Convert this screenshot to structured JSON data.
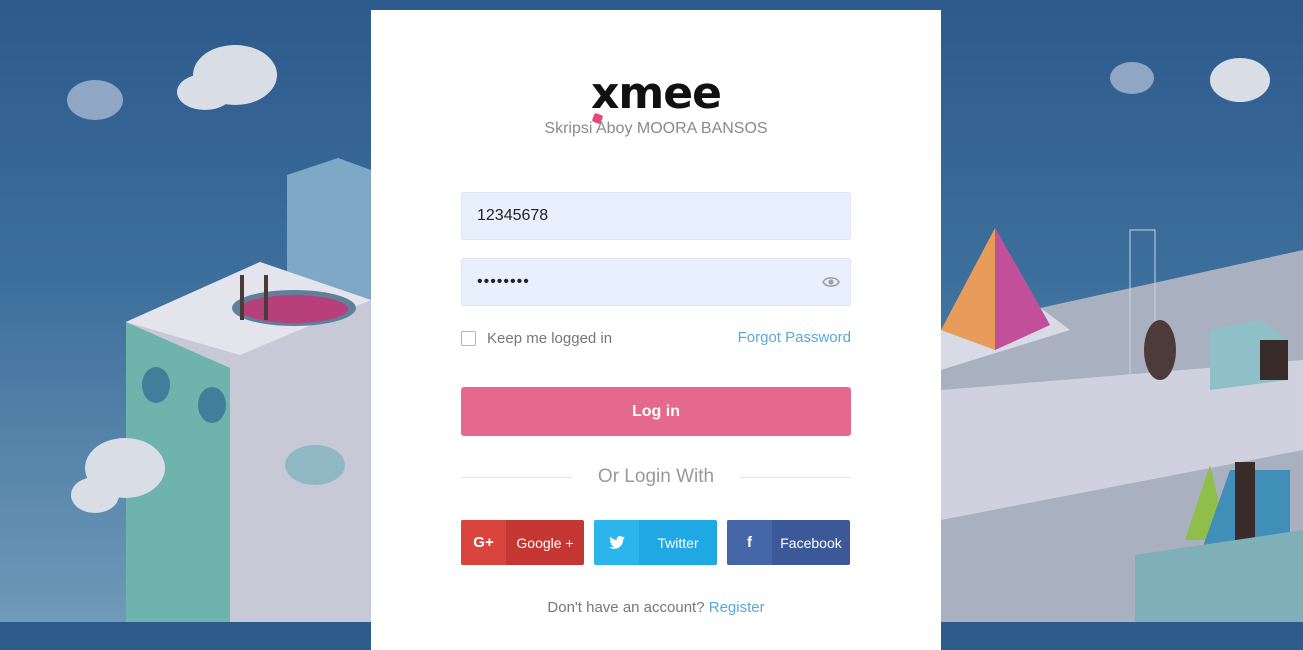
{
  "app": {
    "logo_text": "xmee",
    "subtitle": "Skripsi Aboy MOORA BANSOS"
  },
  "form": {
    "username_value": "12345678",
    "password_value": "••••••••",
    "remember_label": "Keep me logged in",
    "remember_checked": false,
    "forgot_label": "Forgot Password",
    "login_label": "Log in",
    "divider_label": "Or Login With"
  },
  "social": {
    "google": {
      "icon": "G+",
      "label": "Google +"
    },
    "twitter": {
      "icon": "twitter-icon",
      "label": "Twitter"
    },
    "facebook": {
      "icon": "f",
      "label": "Facebook"
    }
  },
  "footer": {
    "prompt": "Don't have an account?",
    "register_label": "Register"
  },
  "colors": {
    "accent": "#e5698f",
    "link": "#5aa7d9",
    "google": "#c53531",
    "twitter": "#1fa8e3",
    "facebook": "#3b5998"
  }
}
